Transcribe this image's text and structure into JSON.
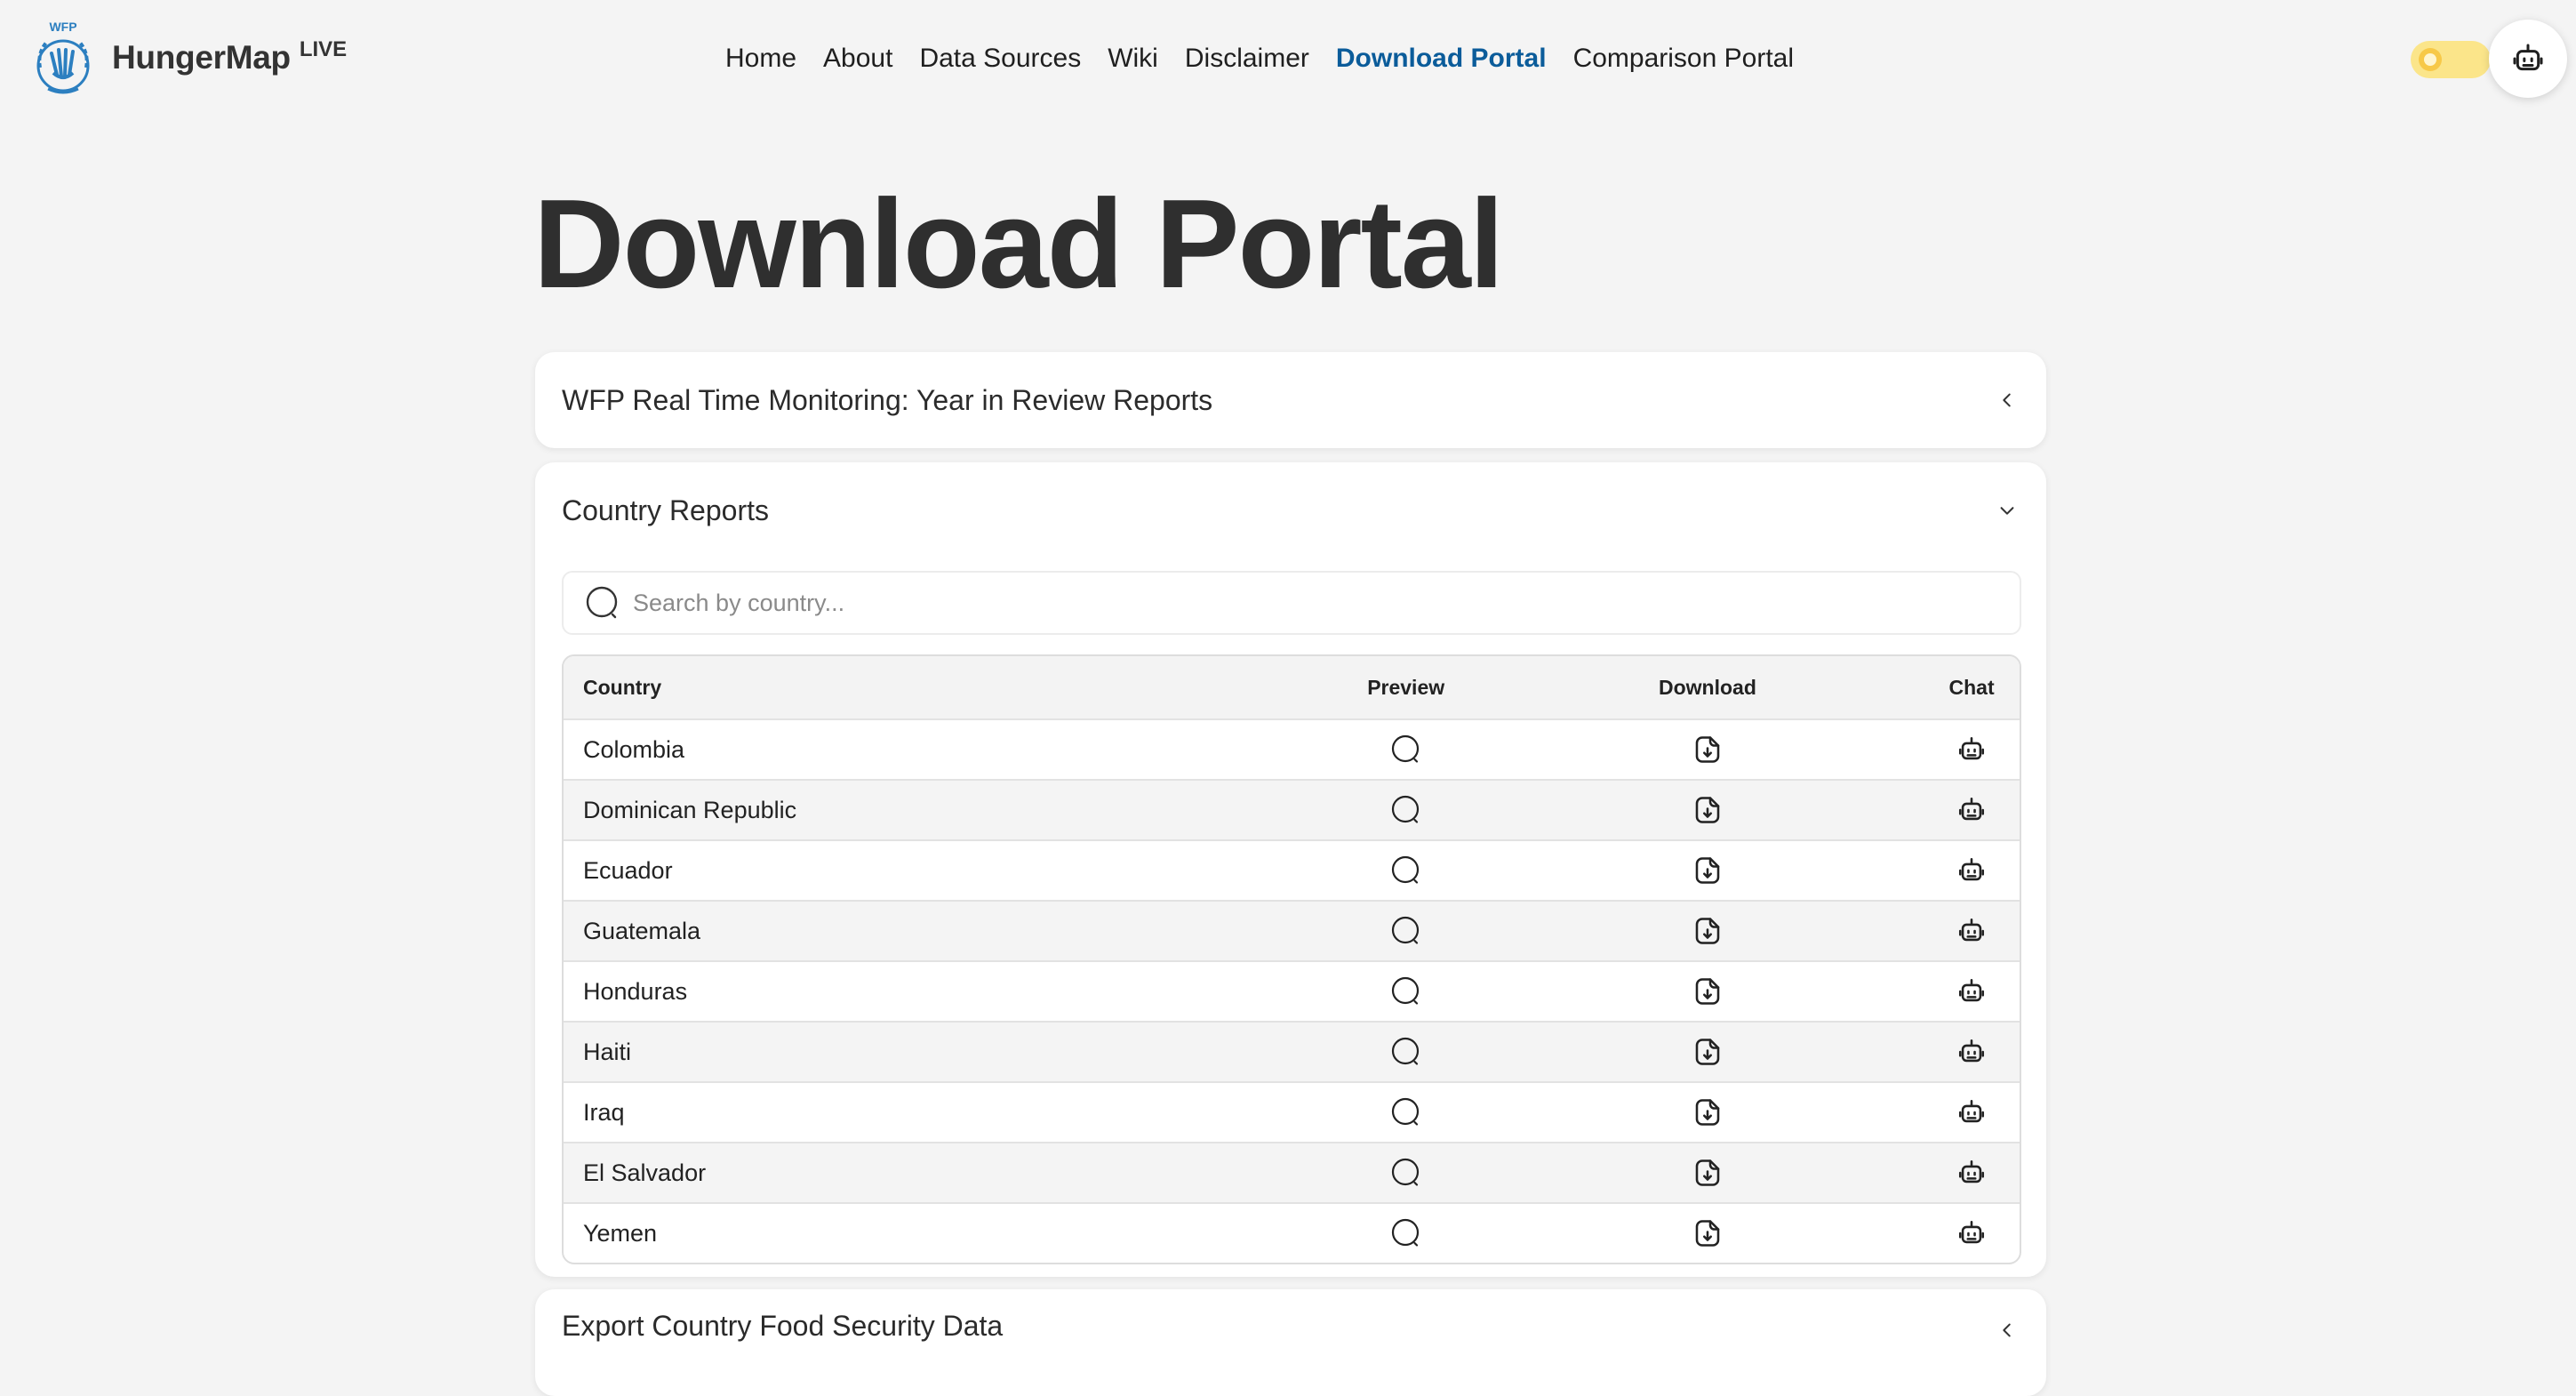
{
  "header": {
    "logo_badge": "WFP",
    "logo_name": "HungerMap",
    "logo_suffix": "LIVE",
    "nav": [
      {
        "label": "Home",
        "active": false
      },
      {
        "label": "About",
        "active": false
      },
      {
        "label": "Data Sources",
        "active": false
      },
      {
        "label": "Wiki",
        "active": false
      },
      {
        "label": "Disclaimer",
        "active": false
      },
      {
        "label": "Download Portal",
        "active": true
      },
      {
        "label": "Comparison Portal",
        "active": false
      }
    ],
    "theme_toggle_icon": "sun-icon",
    "chat_icon": "robot-icon"
  },
  "page": {
    "title": "Download Portal"
  },
  "sections": {
    "year_in_review": {
      "title": "WFP Real Time Monitoring: Year in Review Reports",
      "expanded": false
    },
    "country_reports": {
      "title": "Country Reports",
      "expanded": true,
      "search_placeholder": "Search by country...",
      "search_value": "",
      "columns": {
        "country": "Country",
        "preview": "Preview",
        "download": "Download",
        "chat": "Chat"
      },
      "rows": [
        "Colombia",
        "Dominican Republic",
        "Ecuador",
        "Guatemala",
        "Honduras",
        "Haiti",
        "Iraq",
        "El Salvador",
        "Yemen"
      ]
    },
    "export_food_security": {
      "title": "Export Country Food Security Data",
      "expanded": false
    }
  },
  "colors": {
    "accent": "#0b5c9a",
    "toggle": "#fbe58a",
    "background": "#f4f4f4"
  }
}
